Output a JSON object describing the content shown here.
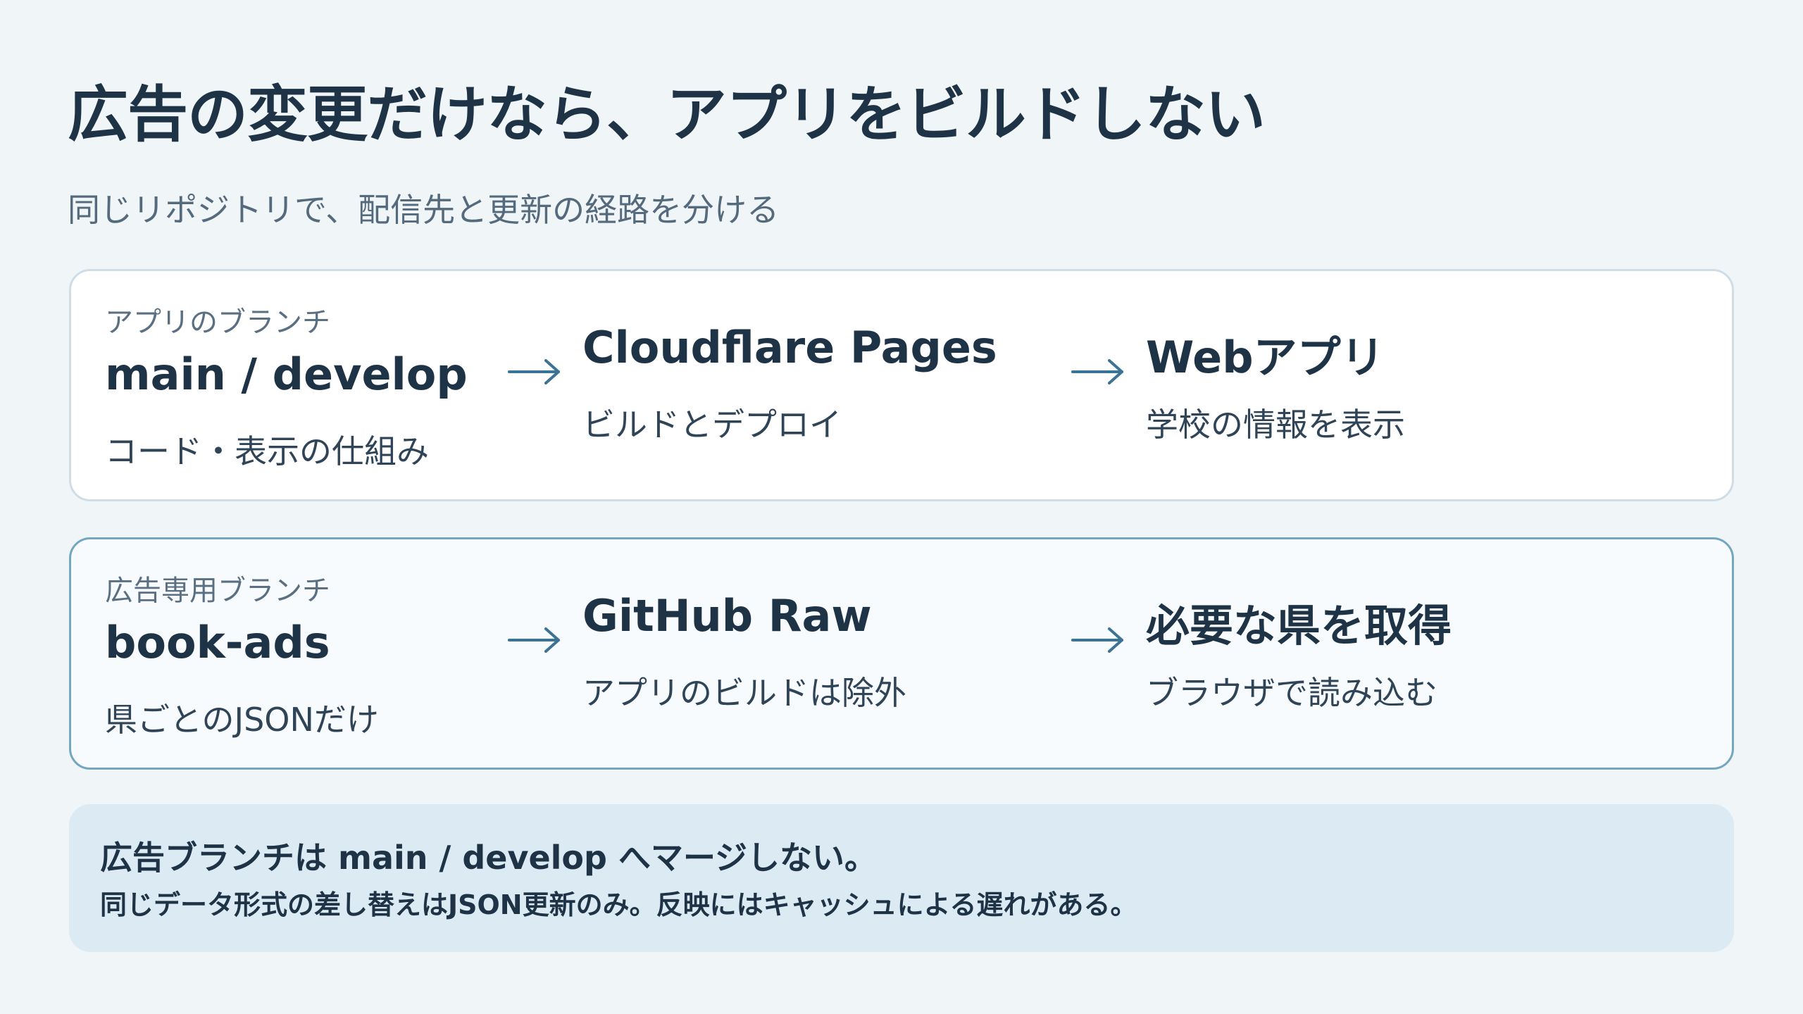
{
  "title": "広告の変更だけなら、アプリをビルドしない",
  "subtitle": "同じリポジトリで、配信先と更新の経路を分ける",
  "colors": {
    "accent_arrow": "#3a7396",
    "card_border_app": "#cfdde6",
    "card_border_ads": "#75a6bf",
    "note_background": "#dcebf3"
  },
  "flows": [
    {
      "tag": "アプリのブランチ",
      "branch": "main / develop",
      "branch_desc": "コード・表示の仕組み",
      "arrow_icon": "right-arrow-icon",
      "steps": [
        {
          "title": "Cloudflare Pages",
          "desc": "ビルドとデプロイ"
        },
        {
          "title": "Webアプリ",
          "desc": "学校の情報を表示"
        }
      ]
    },
    {
      "tag": "広告専用ブランチ",
      "branch": "book-ads",
      "branch_desc": "県ごとのJSONだけ",
      "arrow_icon": "right-arrow-icon",
      "steps": [
        {
          "title": "GitHub Raw",
          "desc": "アプリのビルドは除外"
        },
        {
          "title": "必要な県を取得",
          "desc": "ブラウザで読み込む"
        }
      ]
    }
  ],
  "note": {
    "line1": "広告ブランチは main / develop へマージしない。",
    "line2": "同じデータ形式の差し替えはJSON更新のみ。反映にはキャッシュによる遅れがある。"
  }
}
